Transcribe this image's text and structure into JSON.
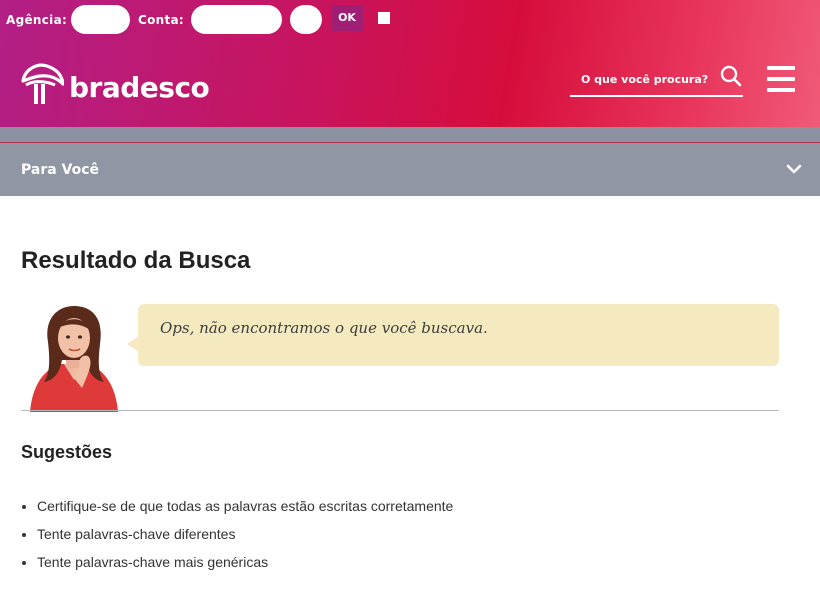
{
  "login": {
    "agencia_label": "Agência:",
    "conta_label": "Conta:",
    "ok_label": "OK"
  },
  "brand": {
    "name": "bradesco",
    "logo_icon": "bradesco-tree-icon"
  },
  "search": {
    "placeholder": "O que você procura?",
    "icon": "search-icon"
  },
  "menu": {
    "icon": "hamburger-menu-icon"
  },
  "section": {
    "title": "Para Você",
    "icon": "chevron-down-icon"
  },
  "main": {
    "title": "Resultado da Busca",
    "message": "Ops, não encontramos o que você buscava.",
    "suggestions_title": "Sugestões",
    "suggestions": [
      "Certifique-se de que todas as palavras estão escritas corretamente",
      "Tente palavras-chave diferentes",
      "Tente palavras-chave mais genéricas"
    ]
  },
  "colors": {
    "header_gradient_start": "#b21f86",
    "header_gradient_mid": "#d60d3c",
    "header_gradient_end": "#f05a78",
    "section_bar": "#9096a4",
    "message_bubble": "#f5e9bf"
  }
}
